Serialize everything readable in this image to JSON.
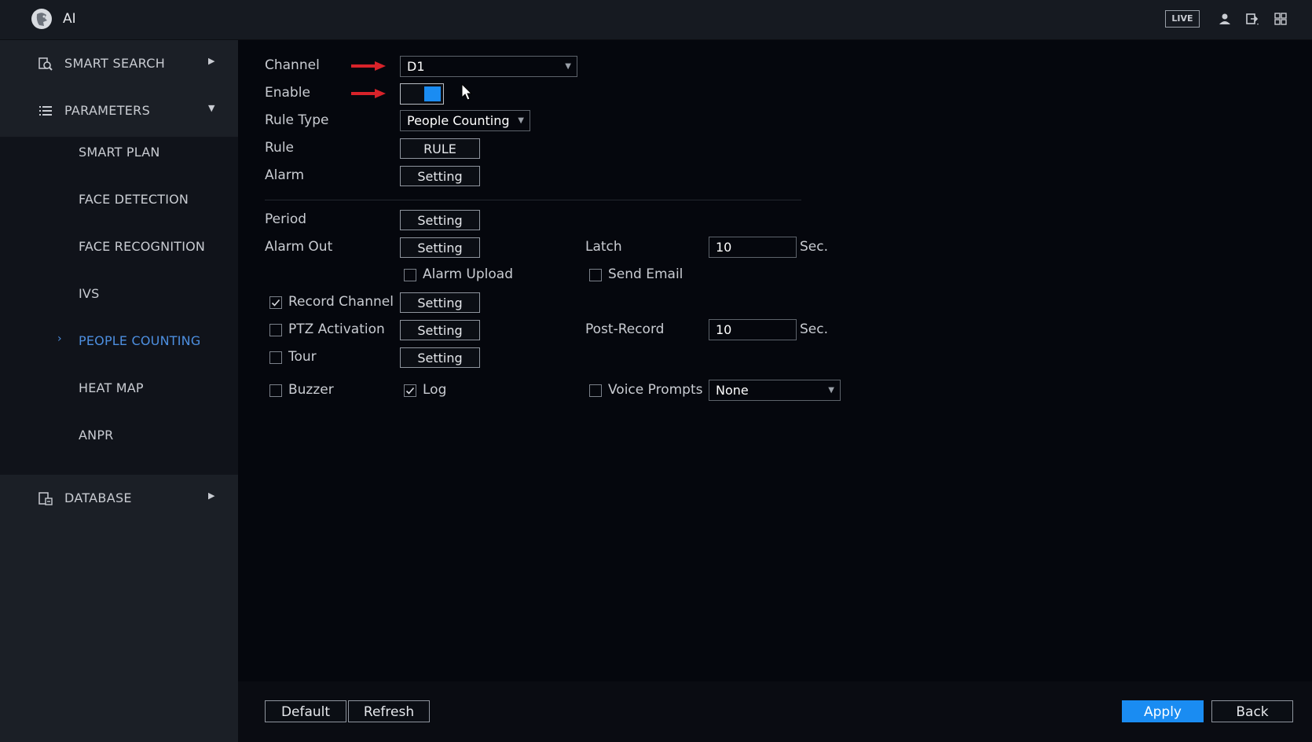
{
  "header": {
    "title": "AI",
    "live_label": "LIVE"
  },
  "sidebar": {
    "smart_search": "SMART SEARCH",
    "parameters": "PARAMETERS",
    "items": [
      "SMART PLAN",
      "FACE DETECTION",
      "FACE RECOGNITION",
      "IVS",
      "PEOPLE COUNTING",
      "HEAT MAP",
      "ANPR"
    ],
    "active_item": "PEOPLE COUNTING",
    "database": "DATABASE"
  },
  "form": {
    "channel_label": "Channel",
    "channel_value": "D1",
    "enable_label": "Enable",
    "enable_on": true,
    "rule_type_label": "Rule Type",
    "rule_type_value": "People Counting",
    "rule_label": "Rule",
    "rule_button": "RULE",
    "alarm_label": "Alarm",
    "setting": "Setting",
    "period_label": "Period",
    "alarm_out_label": "Alarm Out",
    "latch_label": "Latch",
    "latch_value": "10",
    "sec_unit": "Sec.",
    "alarm_upload_label": "Alarm Upload",
    "alarm_upload_checked": false,
    "send_email_label": "Send Email",
    "send_email_checked": false,
    "record_channel_label": "Record Channel",
    "record_channel_checked": true,
    "ptz_activation_label": "PTZ Activation",
    "ptz_activation_checked": false,
    "post_record_label": "Post-Record",
    "post_record_value": "10",
    "tour_label": "Tour",
    "tour_checked": false,
    "buzzer_label": "Buzzer",
    "buzzer_checked": false,
    "log_label": "Log",
    "log_checked": true,
    "voice_prompts_label": "Voice Prompts",
    "voice_prompts_checked": false,
    "voice_prompts_value": "None"
  },
  "footer": {
    "default_label": "Default",
    "refresh_label": "Refresh",
    "apply_label": "Apply",
    "back_label": "Back"
  },
  "colors": {
    "accent": "#1a8cf2",
    "active_menu": "#4d8fe0",
    "annotation_arrow": "#d8232a"
  }
}
